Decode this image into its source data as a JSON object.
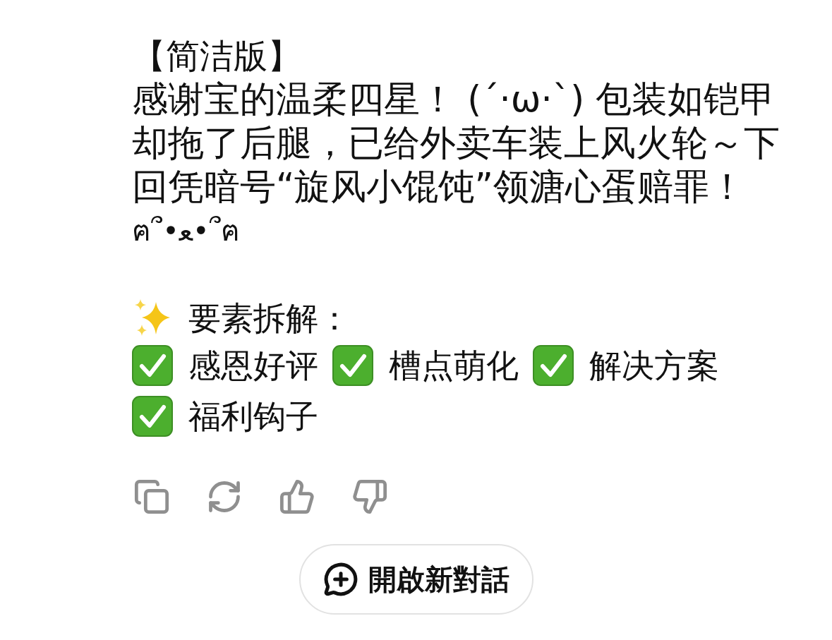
{
  "message": {
    "title": "【简洁版】",
    "paragraph": "感谢宝的温柔四星！ (´·ω·`) 包装如铠甲却拖了后腿，已给外卖车装上风火轮～下回凭暗号“旋风小馄饨”领溏心蛋赔罪！",
    "kaomoji": "ฅ՞•ﻌ•՞ฅ",
    "breakdown_heading": "要素拆解：",
    "elements": [
      "感恩好评",
      "槽点萌化",
      "解决方案",
      "福利钩子"
    ]
  },
  "actions": [
    {
      "kind": "copy"
    },
    {
      "kind": "regenerate"
    },
    {
      "kind": "like"
    },
    {
      "kind": "dislike"
    }
  ],
  "new_chat_button": "開啟新對話"
}
